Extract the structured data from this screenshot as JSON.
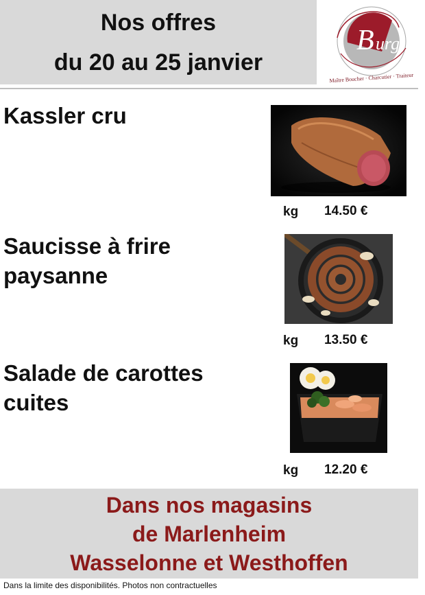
{
  "header": {
    "line1": "Nos offres",
    "line2": "du 20 au 25 janvier"
  },
  "logo": {
    "letters": "Burg",
    "tagline": "Maître Boucher · Charcutier · Traiteur"
  },
  "products": [
    {
      "name_line1": "Kassler cru",
      "name_line2": "",
      "unit": "kg",
      "price": "14.50 €"
    },
    {
      "name_line1": "Saucisse à frire",
      "name_line2": "paysanne",
      "unit": "kg",
      "price": "13.50 €"
    },
    {
      "name_line1": "Salade de carottes",
      "name_line2": "cuites",
      "unit": "kg",
      "price": "12.20 €"
    }
  ],
  "footer": {
    "line1": "Dans nos magasins",
    "line2": "de Marlenheim",
    "line3": "Wasselonne et Westhoffen"
  },
  "disclaimer": "Dans la limite des disponibilités. Photos non contractuelles",
  "colors": {
    "band_gray": "#d9d9d9",
    "accent_red": "#8b1a1a"
  }
}
